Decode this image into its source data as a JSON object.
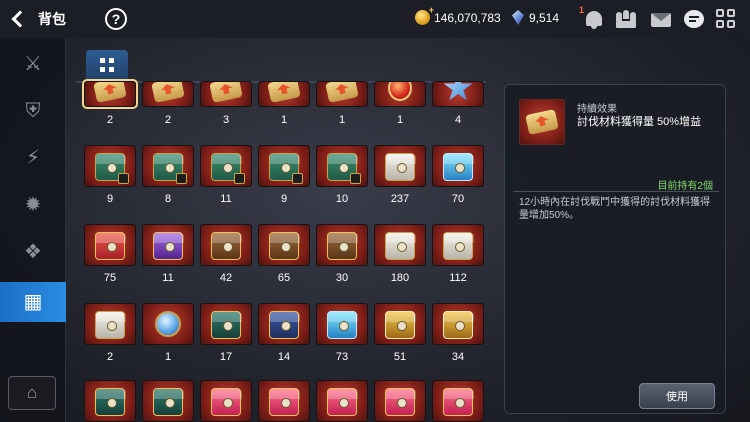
{
  "header": {
    "title": "背包",
    "help_label": "?"
  },
  "currencies": {
    "gold": "146,070,783",
    "gems": "9,514"
  },
  "notifications": {
    "bell_badge": "1"
  },
  "sidebar": {
    "items": [
      {
        "id": "equipment",
        "glyph": "⚔",
        "active": false
      },
      {
        "id": "shield",
        "glyph": "⛨",
        "active": false
      },
      {
        "id": "skill",
        "glyph": "⚡",
        "active": false
      },
      {
        "id": "material",
        "glyph": "✹",
        "active": false
      },
      {
        "id": "misc",
        "glyph": "❖",
        "active": false
      },
      {
        "id": "chest",
        "glyph": "▦",
        "active": true
      }
    ],
    "bottom_glyph": "⌂"
  },
  "inventory": {
    "rows": [
      {
        "counts": [
          "2",
          "2",
          "3",
          "1",
          "1",
          "1",
          "4"
        ]
      },
      {
        "counts": [
          "9",
          "8",
          "11",
          "9",
          "10",
          "237",
          "70"
        ]
      },
      {
        "counts": [
          "75",
          "11",
          "42",
          "65",
          "30",
          "180",
          "112"
        ]
      },
      {
        "counts": [
          "2",
          "1",
          "17",
          "14",
          "73",
          "51",
          "34"
        ]
      },
      {
        "counts": [
          "",
          "",
          "",
          "",
          "",
          "",
          ""
        ]
      }
    ]
  },
  "detail": {
    "label": "持續效果",
    "name": "討伐材料獲得量 50%增益",
    "owned": "目前持有2個",
    "description": "12小時內在討伐戰鬥中獲得的討伐材料獲得量增加50%。",
    "use_label": "使用"
  }
}
